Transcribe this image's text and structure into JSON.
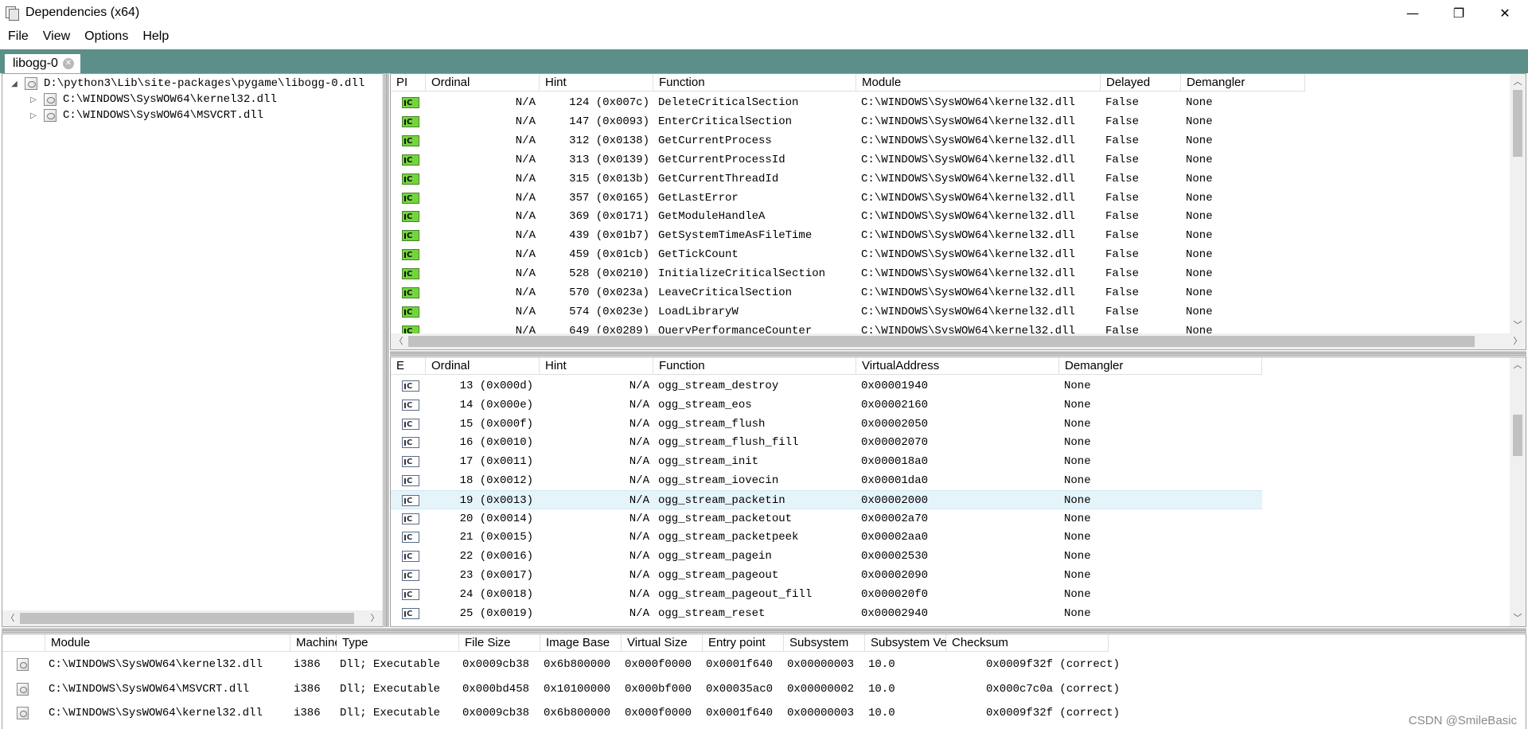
{
  "window": {
    "title": "Dependencies (x64)",
    "minimize_glyph": "—",
    "restore_glyph": "❐",
    "close_glyph": "✕"
  },
  "menu": [
    "File",
    "View",
    "Options",
    "Help"
  ],
  "tab": {
    "label": "libogg-0",
    "close_glyph": "✕"
  },
  "tree": [
    {
      "label": "D:\\python3\\Lib\\site-packages\\pygame\\libogg-0.dll",
      "arrow": "◢",
      "level": 0
    },
    {
      "label": "C:\\WINDOWS\\SysWOW64\\kernel32.dll",
      "arrow": "▷",
      "level": 1
    },
    {
      "label": "C:\\WINDOWS\\SysWOW64\\MSVCRT.dll",
      "arrow": "▷",
      "level": 1
    }
  ],
  "imports": {
    "columns": [
      "PI",
      "Ordinal",
      "Hint",
      "Function",
      "Module",
      "Delayed",
      "Demangler"
    ],
    "rows": [
      {
        "ordinal": "N/A",
        "hint": "124  (0x007c)",
        "function": "DeleteCriticalSection",
        "module": "C:\\WINDOWS\\SysWOW64\\kernel32.dll",
        "delayed": "False",
        "demangler": "None"
      },
      {
        "ordinal": "N/A",
        "hint": "147  (0x0093)",
        "function": "EnterCriticalSection",
        "module": "C:\\WINDOWS\\SysWOW64\\kernel32.dll",
        "delayed": "False",
        "demangler": "None"
      },
      {
        "ordinal": "N/A",
        "hint": "312  (0x0138)",
        "function": "GetCurrentProcess",
        "module": "C:\\WINDOWS\\SysWOW64\\kernel32.dll",
        "delayed": "False",
        "demangler": "None"
      },
      {
        "ordinal": "N/A",
        "hint": "313  (0x0139)",
        "function": "GetCurrentProcessId",
        "module": "C:\\WINDOWS\\SysWOW64\\kernel32.dll",
        "delayed": "False",
        "demangler": "None"
      },
      {
        "ordinal": "N/A",
        "hint": "315  (0x013b)",
        "function": "GetCurrentThreadId",
        "module": "C:\\WINDOWS\\SysWOW64\\kernel32.dll",
        "delayed": "False",
        "demangler": "None"
      },
      {
        "ordinal": "N/A",
        "hint": "357  (0x0165)",
        "function": "GetLastError",
        "module": "C:\\WINDOWS\\SysWOW64\\kernel32.dll",
        "delayed": "False",
        "demangler": "None"
      },
      {
        "ordinal": "N/A",
        "hint": "369  (0x0171)",
        "function": "GetModuleHandleA",
        "module": "C:\\WINDOWS\\SysWOW64\\kernel32.dll",
        "delayed": "False",
        "demangler": "None"
      },
      {
        "ordinal": "N/A",
        "hint": "439  (0x01b7)",
        "function": "GetSystemTimeAsFileTime",
        "module": "C:\\WINDOWS\\SysWOW64\\kernel32.dll",
        "delayed": "False",
        "demangler": "None"
      },
      {
        "ordinal": "N/A",
        "hint": "459  (0x01cb)",
        "function": "GetTickCount",
        "module": "C:\\WINDOWS\\SysWOW64\\kernel32.dll",
        "delayed": "False",
        "demangler": "None"
      },
      {
        "ordinal": "N/A",
        "hint": "528  (0x0210)",
        "function": "InitializeCriticalSection",
        "module": "C:\\WINDOWS\\SysWOW64\\kernel32.dll",
        "delayed": "False",
        "demangler": "None"
      },
      {
        "ordinal": "N/A",
        "hint": "570  (0x023a)",
        "function": "LeaveCriticalSection",
        "module": "C:\\WINDOWS\\SysWOW64\\kernel32.dll",
        "delayed": "False",
        "demangler": "None"
      },
      {
        "ordinal": "N/A",
        "hint": "574  (0x023e)",
        "function": "LoadLibraryW",
        "module": "C:\\WINDOWS\\SysWOW64\\kernel32.dll",
        "delayed": "False",
        "demangler": "None"
      },
      {
        "ordinal": "N/A",
        "hint": "649  (0x0289)",
        "function": "QueryPerformanceCounter",
        "module": "C:\\WINDOWS\\SysWOW64\\kernel32.dll",
        "delayed": "False",
        "demangler": "None"
      }
    ]
  },
  "exports": {
    "columns": [
      "E",
      "Ordinal",
      "Hint",
      "Function",
      "VirtualAddress",
      "Demangler"
    ],
    "rows": [
      {
        "ordinal": "13  (0x000d)",
        "hint": "N/A",
        "function": "ogg_stream_destroy",
        "address": "0x00001940",
        "demangler": "None"
      },
      {
        "ordinal": "14  (0x000e)",
        "hint": "N/A",
        "function": "ogg_stream_eos",
        "address": "0x00002160",
        "demangler": "None"
      },
      {
        "ordinal": "15  (0x000f)",
        "hint": "N/A",
        "function": "ogg_stream_flush",
        "address": "0x00002050",
        "demangler": "None"
      },
      {
        "ordinal": "16  (0x0010)",
        "hint": "N/A",
        "function": "ogg_stream_flush_fill",
        "address": "0x00002070",
        "demangler": "None"
      },
      {
        "ordinal": "17  (0x0011)",
        "hint": "N/A",
        "function": "ogg_stream_init",
        "address": "0x000018a0",
        "demangler": "None"
      },
      {
        "ordinal": "18  (0x0012)",
        "hint": "N/A",
        "function": "ogg_stream_iovecin",
        "address": "0x00001da0",
        "demangler": "None"
      },
      {
        "ordinal": "19  (0x0013)",
        "hint": "N/A",
        "function": "ogg_stream_packetin",
        "address": "0x00002000",
        "demangler": "None"
      },
      {
        "ordinal": "20  (0x0014)",
        "hint": "N/A",
        "function": "ogg_stream_packetout",
        "address": "0x00002a70",
        "demangler": "None"
      },
      {
        "ordinal": "21  (0x0015)",
        "hint": "N/A",
        "function": "ogg_stream_packetpeek",
        "address": "0x00002aa0",
        "demangler": "None"
      },
      {
        "ordinal": "22  (0x0016)",
        "hint": "N/A",
        "function": "ogg_stream_pagein",
        "address": "0x00002530",
        "demangler": "None"
      },
      {
        "ordinal": "23  (0x0017)",
        "hint": "N/A",
        "function": "ogg_stream_pageout",
        "address": "0x00002090",
        "demangler": "None"
      },
      {
        "ordinal": "24  (0x0018)",
        "hint": "N/A",
        "function": "ogg_stream_pageout_fill",
        "address": "0x000020f0",
        "demangler": "None"
      },
      {
        "ordinal": "25  (0x0019)",
        "hint": "N/A",
        "function": "ogg_stream_reset",
        "address": "0x00002940",
        "demangler": "None"
      }
    ],
    "selected_index": 6
  },
  "modules": {
    "columns": [
      "",
      "Module",
      "Machine",
      "Type",
      "File Size",
      "Image Base",
      "Virtual Size",
      "Entry point",
      "Subsystem",
      "Subsystem Ver.",
      "Checksum"
    ],
    "rows": [
      {
        "module": "C:\\WINDOWS\\SysWOW64\\kernel32.dll",
        "machine": "i386",
        "type": "Dll; Executable",
        "file_size": "0x0009cb38",
        "image_base": "0x6b800000",
        "virtual_size": "0x000f0000",
        "entry_point": "0x0001f640",
        "subsystem": "0x00000003",
        "subsystem_ver": "10.0",
        "checksum": "0x0009f32f (correct)"
      },
      {
        "module": "C:\\WINDOWS\\SysWOW64\\MSVCRT.dll",
        "machine": "i386",
        "type": "Dll; Executable",
        "file_size": "0x000bd458",
        "image_base": "0x10100000",
        "virtual_size": "0x000bf000",
        "entry_point": "0x00035ac0",
        "subsystem": "0x00000002",
        "subsystem_ver": "10.0",
        "checksum": "0x000c7c0a (correct)"
      },
      {
        "module": "C:\\WINDOWS\\SysWOW64\\kernel32.dll",
        "machine": "i386",
        "type": "Dll; Executable",
        "file_size": "0x0009cb38",
        "image_base": "0x6b800000",
        "virtual_size": "0x000f0000",
        "entry_point": "0x0001f640",
        "subsystem": "0x00000003",
        "subsystem_ver": "10.0",
        "checksum": "0x0009f32f (correct)"
      }
    ]
  },
  "scroll_glyphs": {
    "up": "︿",
    "down": "﹀",
    "left": "〈",
    "right": "〉"
  },
  "watermark": "CSDN @SmileBasic"
}
